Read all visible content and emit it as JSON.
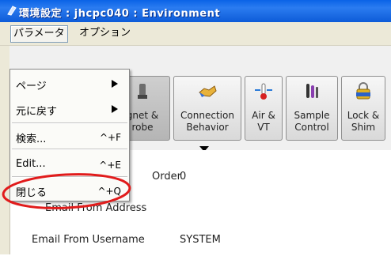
{
  "window": {
    "title": "環境設定 : jhcpc040 : Environment"
  },
  "menubar": {
    "items": [
      "パラメータ",
      "オプション"
    ]
  },
  "toolbar": {
    "buttons": [
      {
        "label": "Magnet & Probe",
        "visible_label": "gnet & robe",
        "icon": "magnet-probe-icon"
      },
      {
        "label": "Connection Behavior",
        "icon": "handshake-icon"
      },
      {
        "label": "Air & VT",
        "icon": "thermometer-icon"
      },
      {
        "label": "Sample Control",
        "icon": "sample-tubes-icon"
      },
      {
        "label": "Lock & Shim",
        "icon": "lock-auto-icon"
      }
    ]
  },
  "content": {
    "rows": [
      {
        "label": "Order",
        "visible_label": "Order",
        "value": "0"
      },
      {
        "label": "Email From Address",
        "visible_label": "Email From Address",
        "value": ""
      },
      {
        "label": "Email From Username",
        "value": "SYSTEM"
      }
    ]
  },
  "dropdown": {
    "items": [
      {
        "label": "ページ",
        "shortcut": "",
        "submenu": true
      },
      {
        "label": "元に戻す",
        "shortcut": "",
        "submenu": true
      },
      {
        "label": "検索...",
        "shortcut": "^+F",
        "submenu": false
      },
      {
        "label": "Edit...",
        "shortcut": "^+E",
        "submenu": false
      },
      {
        "label": "閉じる",
        "shortcut": "^+Q",
        "submenu": false
      }
    ]
  },
  "colors": {
    "titlebar": "#0a63e6",
    "annotation": "#e11b1b",
    "menu_bg": "#ece9d8"
  }
}
